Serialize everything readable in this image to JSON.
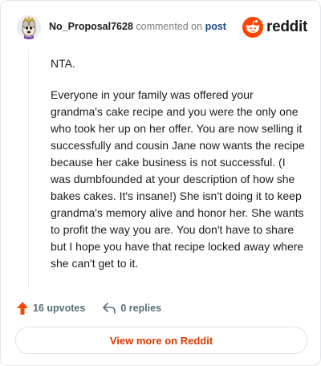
{
  "header": {
    "username": "No_Proposal7628",
    "action_text": "commented on",
    "post_link": "post",
    "brand": "reddit"
  },
  "comment": {
    "paragraphs": [
      "NTA.",
      "Everyone in your family was offered your grandma's cake recipe and you were the only one who took her up on her offer. You are now selling it successfully and cousin Jane now wants the recipe because her cake business is not successful. (I was dumbfounded at your description of how she bakes cakes. It's insane!) She isn't doing it to keep grandma's memory alive and honor her. She wants to profit the way you are. You don't have to share but I hope you have that recipe locked away where she can't get to it."
    ]
  },
  "actions": {
    "upvotes": "16 upvotes",
    "replies": "0 replies"
  },
  "footer": {
    "view_more": "View more on Reddit"
  },
  "colors": {
    "upvote": "#ff4500",
    "brand": "#ff4500",
    "link": "#d93a00"
  }
}
